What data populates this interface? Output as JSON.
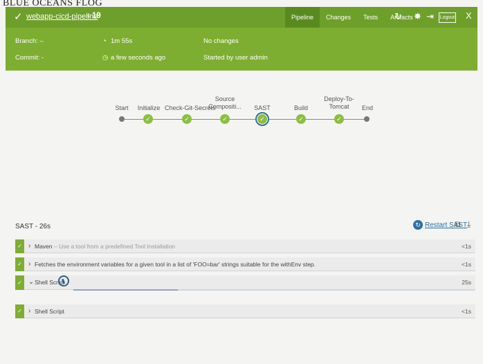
{
  "caption": "BLUE OCEANS FLOG",
  "header": {
    "status_icon": "check-icon",
    "pipeline_name": "webapp-cicd-pipeline",
    "run_number": "‹ 19",
    "tabs": [
      "Pipeline",
      "Changes",
      "Tests",
      "Artifacts"
    ],
    "active_tab": "Pipeline",
    "logout_label": "Logout",
    "close_label": "X",
    "color": "#6e9f2a"
  },
  "summary": {
    "branch": "Branch: –",
    "commit": "Commit: -",
    "duration": "1m 55s",
    "started": "a few seconds ago",
    "changes": "No changes",
    "started_by": "Started by user admin"
  },
  "stages": [
    {
      "name": "Start",
      "status": "start"
    },
    {
      "name": "Initialize",
      "status": "success"
    },
    {
      "name": "Check-Git-Secrets",
      "status": "success"
    },
    {
      "name": "Source Compositi...",
      "status": "success"
    },
    {
      "name": "SAST",
      "status": "selected"
    },
    {
      "name": "Build",
      "status": "success"
    },
    {
      "name": "Deploy-To-Tomcat",
      "status": "success"
    },
    {
      "name": "End",
      "status": "end"
    }
  ],
  "detail": {
    "title": "SAST - 26s",
    "restart_label": "Restart SAST",
    "steps": [
      {
        "label": "Maven",
        "desc": " – Use a tool from a predefined Tool Installation",
        "duration": "<1s",
        "expanded": false
      },
      {
        "label": "Fetches the environment variables for a given tool in a list of 'FOO=bar' strings suitable for the withEnv step.",
        "desc": "",
        "duration": "<1s",
        "expanded": false
      },
      {
        "label": "Shell Script",
        "desc": "",
        "duration": "25s",
        "expanded": true
      },
      {
        "label": "Shell Script",
        "desc": "",
        "duration": "<1s",
        "expanded": false
      }
    ],
    "progress": 0.26
  }
}
